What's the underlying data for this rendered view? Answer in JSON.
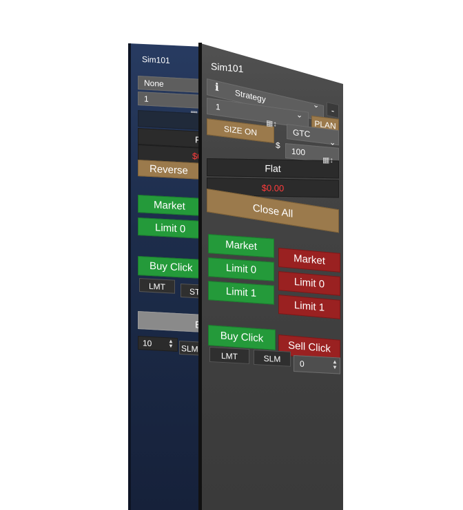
{
  "back_panel": {
    "account": "Sim101",
    "atm": "None",
    "quantity": "1",
    "position_label": "F",
    "pnl": "$0",
    "reverse_label": "Reverse",
    "market_label": "Market",
    "limit_label": "Limit 0",
    "buy_click_label": "Buy Click",
    "lmt_label": "LMT",
    "stop_label": "ST",
    "bracket_label": "Bra",
    "qty_input": "10",
    "slm_label": "SLM"
  },
  "front_panel": {
    "account": "Sim101",
    "info_icon": "info-icon",
    "strategy": "Strategy",
    "minus_label": "-",
    "quantity": "1",
    "plan_label": "PLAN",
    "size_on_label": "SIZE ON",
    "tif": "GTC",
    "currency": "$",
    "amount": "100",
    "position_label": "Flat",
    "pnl": "$0.00",
    "close_all_label": "Close All",
    "buy_market_label": "Market",
    "buy_limit0_label": "Limit 0",
    "buy_limit1_label": "Limit 1",
    "sell_market_label": "Market",
    "sell_limit0_label": "Limit 0",
    "sell_limit1_label": "Limit 1",
    "buy_click_label": "Buy Click",
    "sell_click_label": "Sell Click",
    "lmt_label": "LMT",
    "slm_label": "SLM",
    "offset_value": "0"
  },
  "colors": {
    "buy": "#249a3a",
    "sell": "#9a2121",
    "close_all": "#9b7a4c",
    "pnl": "#ff3b3b"
  }
}
